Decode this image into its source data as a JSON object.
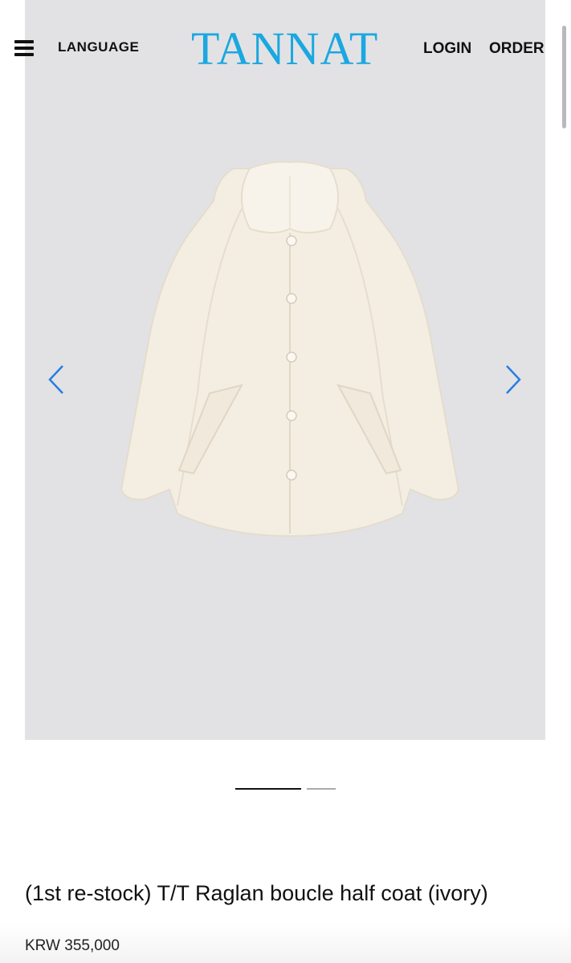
{
  "header": {
    "language_label": "LANGUAGE",
    "logo": "TANNAT",
    "login_label": "LOGIN",
    "order_label": "ORDER",
    "menu_icon": "hamburger-menu-icon"
  },
  "gallery": {
    "image_alt": "ivory raglan boucle half coat",
    "prev_icon": "chevron-left-icon",
    "next_icon": "chevron-right-icon",
    "arrow_color": "#2a7de1",
    "background_color": "#e2e2e5",
    "slide_count": 2,
    "active_slide": 1
  },
  "product": {
    "title": "(1st re-stock) T/T Raglan boucle half coat (ivory)",
    "price": "KRW 355,000"
  },
  "colors": {
    "brand": "#1ba7e0",
    "coat": "#f3ecdf"
  }
}
